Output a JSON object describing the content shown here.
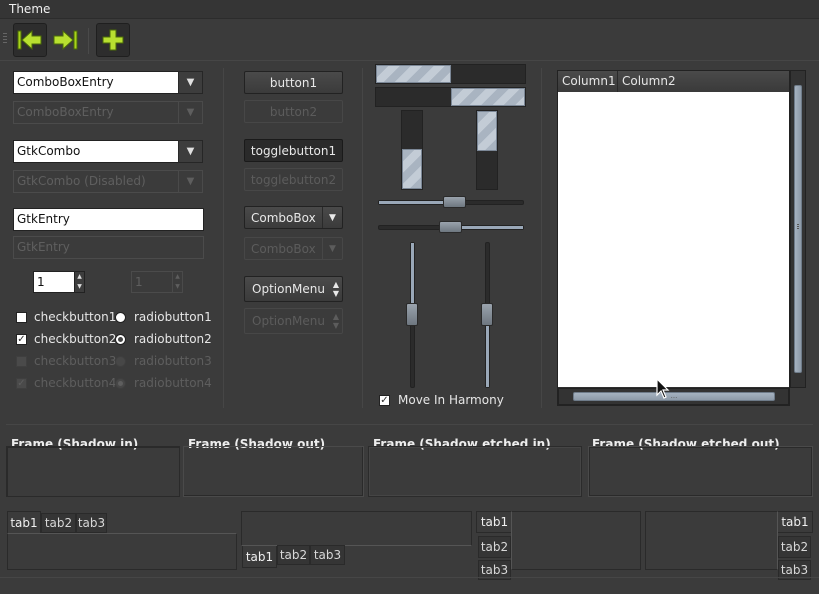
{
  "menubar": {
    "theme_label": "Theme"
  },
  "toolbar": {
    "back_icon": "arrow-left-icon",
    "forward_icon": "arrow-right-icon",
    "add_icon": "plus-icon"
  },
  "col1": {
    "combo_entry": {
      "value": "ComboBoxEntry"
    },
    "combo_entry_disabled": {
      "value": "ComboBoxEntry"
    },
    "gtk_combo": {
      "value": "GtkCombo"
    },
    "gtk_combo_disabled": {
      "value": "GtkCombo (Disabled)"
    },
    "gtk_entry": {
      "value": "GtkEntry"
    },
    "gtk_entry_disabled": {
      "value": "GtkEntry"
    },
    "spin": {
      "value": "1"
    },
    "spin_disabled": {
      "value": "1"
    },
    "checks": [
      "checkbutton1",
      "checkbutton2",
      "checkbutton3",
      "checkbutton4"
    ],
    "radios": [
      "radiobutton1",
      "radiobutton2",
      "radiobutton3",
      "radiobutton4"
    ]
  },
  "col2": {
    "button1": "button1",
    "button2": "button2",
    "toggle1": "togglebutton1",
    "toggle2": "togglebutton2",
    "combobox": "ComboBox",
    "combobox_disabled": "ComboBox",
    "optionmenu": "OptionMenu",
    "optionmenu_disabled": "OptionMenu"
  },
  "col3": {
    "move_in_harmony": "Move In Harmony"
  },
  "tree": {
    "columns": [
      "Column1",
      "Column2"
    ],
    "hscroll_grip": "..."
  },
  "frames": [
    "Frame (Shadow in)",
    "Frame (Shadow out)",
    "Frame (Shadow etched in)",
    "Frame (Shadow etched out)"
  ],
  "tabs": {
    "top": [
      "tab1",
      "tab2",
      "tab3"
    ],
    "bottom": [
      "tab1",
      "tab2",
      "tab3"
    ],
    "left": [
      "tab1",
      "tab2",
      "tab3"
    ],
    "right": [
      "tab1",
      "tab2",
      "tab3"
    ]
  },
  "colors": {
    "background": "#3b3b3b",
    "accent_green": "#a8d41a",
    "progress": "#b6c0cc"
  }
}
